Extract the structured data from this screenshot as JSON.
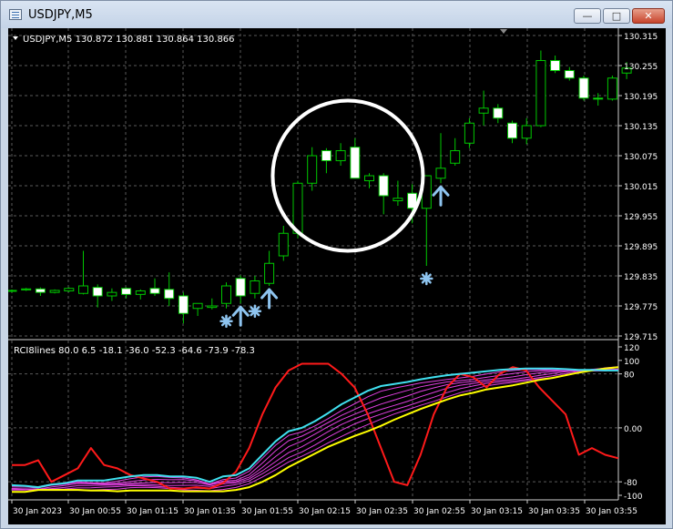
{
  "window": {
    "title": "USDJPY,M5",
    "minimize_label": "—",
    "maximize_label": "□",
    "close_label": "✕"
  },
  "main_chart": {
    "header": "USDJPY,M5  130.872 130.881 130.864 130.866",
    "price_axis": [
      "130.315",
      "130.255",
      "130.195",
      "130.135",
      "130.075",
      "130.015",
      "129.955",
      "129.895",
      "129.835",
      "129.775",
      "129.715"
    ],
    "colors": {
      "bull_body": "#000000",
      "bull_outline": "#00c800",
      "bear_body": "#ffffff",
      "wick": "#00c800",
      "grid": "#5a5a5a",
      "arrow": "#8ec4ef",
      "circle": "#ffffff"
    }
  },
  "indicator": {
    "header": "RCI8lines 80.0 6.5 -18.1 -36.0 -52.3 -64.6 -73.9 -78.3",
    "axis": [
      "120",
      "100",
      "80",
      "0.00",
      "-80",
      "-100"
    ]
  },
  "time_axis": [
    "30 Jan 2023",
    "30 Jan 00:55",
    "30 Jan 01:15",
    "30 Jan 01:35",
    "30 Jan 01:55",
    "30 Jan 02:15",
    "30 Jan 02:35",
    "30 Jan 02:55",
    "30 Jan 03:15",
    "30 Jan 03:35",
    "30 Jan 03:55"
  ],
  "chart_data": {
    "type": "candlestick",
    "candles": [
      {
        "o": 129.805,
        "h": 129.808,
        "l": 129.802,
        "c": 129.806
      },
      {
        "o": 129.807,
        "h": 129.811,
        "l": 129.805,
        "c": 129.809
      },
      {
        "o": 129.809,
        "h": 129.812,
        "l": 129.795,
        "c": 129.802
      },
      {
        "o": 129.802,
        "h": 129.808,
        "l": 129.8,
        "c": 129.806
      },
      {
        "o": 129.805,
        "h": 129.812,
        "l": 129.803,
        "c": 129.81
      },
      {
        "o": 129.8,
        "h": 129.885,
        "l": 129.798,
        "c": 129.815
      },
      {
        "o": 129.812,
        "h": 129.818,
        "l": 129.772,
        "c": 129.795
      },
      {
        "o": 129.795,
        "h": 129.81,
        "l": 129.785,
        "c": 129.802
      },
      {
        "o": 129.81,
        "h": 129.812,
        "l": 129.79,
        "c": 129.798
      },
      {
        "o": 129.798,
        "h": 129.808,
        "l": 129.788,
        "c": 129.805
      },
      {
        "o": 129.81,
        "h": 129.83,
        "l": 129.795,
        "c": 129.8
      },
      {
        "o": 129.808,
        "h": 129.842,
        "l": 129.775,
        "c": 129.79
      },
      {
        "o": 129.795,
        "h": 129.802,
        "l": 129.74,
        "c": 129.76
      },
      {
        "o": 129.77,
        "h": 129.78,
        "l": 129.755,
        "c": 129.78
      },
      {
        "o": 129.772,
        "h": 129.79,
        "l": 129.768,
        "c": 129.775
      },
      {
        "o": 129.78,
        "h": 129.822,
        "l": 129.77,
        "c": 129.815
      },
      {
        "o": 129.83,
        "h": 129.836,
        "l": 129.78,
        "c": 129.795
      },
      {
        "o": 129.8,
        "h": 129.835,
        "l": 129.79,
        "c": 129.825
      },
      {
        "o": 129.82,
        "h": 129.885,
        "l": 129.815,
        "c": 129.86
      },
      {
        "o": 129.875,
        "h": 129.935,
        "l": 129.865,
        "c": 129.92
      },
      {
        "o": 129.92,
        "h": 130.025,
        "l": 129.91,
        "c": 130.02
      },
      {
        "o": 130.02,
        "h": 130.092,
        "l": 130.005,
        "c": 130.075
      },
      {
        "o": 130.085,
        "h": 130.09,
        "l": 130.04,
        "c": 130.065
      },
      {
        "o": 130.065,
        "h": 130.1,
        "l": 130.055,
        "c": 130.085
      },
      {
        "o": 130.092,
        "h": 130.11,
        "l": 130.03,
        "c": 130.03
      },
      {
        "o": 130.025,
        "h": 130.04,
        "l": 130.01,
        "c": 130.035
      },
      {
        "o": 130.035,
        "h": 130.04,
        "l": 129.958,
        "c": 129.995
      },
      {
        "o": 129.985,
        "h": 130.025,
        "l": 129.975,
        "c": 129.99
      },
      {
        "o": 130.0,
        "h": 130.018,
        "l": 129.94,
        "c": 129.97
      },
      {
        "o": 129.97,
        "h": 130.035,
        "l": 129.855,
        "c": 130.035
      },
      {
        "o": 130.03,
        "h": 130.12,
        "l": 130.02,
        "c": 130.05
      },
      {
        "o": 130.06,
        "h": 130.11,
        "l": 130.055,
        "c": 130.085
      },
      {
        "o": 130.1,
        "h": 130.15,
        "l": 130.09,
        "c": 130.14
      },
      {
        "o": 130.16,
        "h": 130.205,
        "l": 130.135,
        "c": 130.17
      },
      {
        "o": 130.17,
        "h": 130.178,
        "l": 130.14,
        "c": 130.15
      },
      {
        "o": 130.14,
        "h": 130.145,
        "l": 130.1,
        "c": 130.11
      },
      {
        "o": 130.11,
        "h": 130.15,
        "l": 130.098,
        "c": 130.135
      },
      {
        "o": 130.135,
        "h": 130.285,
        "l": 130.132,
        "c": 130.265
      },
      {
        "o": 130.265,
        "h": 130.275,
        "l": 130.24,
        "c": 130.245
      },
      {
        "o": 130.245,
        "h": 130.252,
        "l": 130.225,
        "c": 130.23
      },
      {
        "o": 130.23,
        "h": 130.235,
        "l": 130.185,
        "c": 130.19
      },
      {
        "o": 130.19,
        "h": 130.2,
        "l": 130.175,
        "c": 130.188
      },
      {
        "o": 130.188,
        "h": 130.235,
        "l": 130.185,
        "c": 130.23
      },
      {
        "o": 130.24,
        "h": 130.262,
        "l": 130.228,
        "c": 130.25
      }
    ],
    "arrows": [
      {
        "i": 15,
        "type": "star"
      },
      {
        "i": 16,
        "type": "arrow"
      },
      {
        "i": 17,
        "type": "star"
      },
      {
        "i": 18,
        "type": "arrow"
      },
      {
        "i": 29,
        "type": "star"
      },
      {
        "i": 30,
        "type": "arrow"
      }
    ],
    "circle": {
      "i_center": 23.5,
      "price_center": 130.035,
      "i_radius": 5.0
    },
    "rci_series": [
      {
        "name": "rci-red",
        "color": "#ff1a1a",
        "width": 2,
        "values": [
          -55,
          -55,
          -48,
          -80,
          -70,
          -60,
          -30,
          -55,
          -60,
          -70,
          -75,
          -80,
          -90,
          -90,
          -88,
          -90,
          -82,
          -65,
          -30,
          20,
          60,
          85,
          95,
          95,
          95,
          80,
          60,
          20,
          -30,
          -80,
          -85,
          -40,
          20,
          60,
          80,
          75,
          60,
          80,
          90,
          85,
          60,
          40,
          20,
          -40,
          -30,
          -40,
          -45
        ]
      },
      {
        "name": "rci-yellow",
        "color": "#ffff00",
        "width": 2,
        "values": [
          -95,
          -95,
          -92,
          -92,
          -92,
          -92,
          -93,
          -93,
          -94,
          -93,
          -93,
          -93,
          -93,
          -94,
          -94,
          -94,
          -94,
          -92,
          -88,
          -80,
          -70,
          -58,
          -48,
          -38,
          -28,
          -20,
          -12,
          -5,
          3,
          12,
          20,
          28,
          35,
          42,
          48,
          52,
          57,
          60,
          63,
          67,
          71,
          74,
          78,
          82,
          85,
          88,
          90
        ]
      },
      {
        "name": "rci-cyan",
        "color": "#40e0f0",
        "width": 2,
        "values": [
          -85,
          -86,
          -88,
          -84,
          -82,
          -78,
          -78,
          -78,
          -75,
          -72,
          -70,
          -70,
          -72,
          -72,
          -74,
          -80,
          -72,
          -70,
          -60,
          -40,
          -20,
          -5,
          0,
          10,
          22,
          35,
          45,
          55,
          62,
          65,
          68,
          72,
          75,
          78,
          80,
          82,
          84,
          86,
          87,
          88,
          88,
          88,
          87,
          86,
          86,
          85,
          85
        ]
      }
    ],
    "rci_magenta_count": 6
  }
}
